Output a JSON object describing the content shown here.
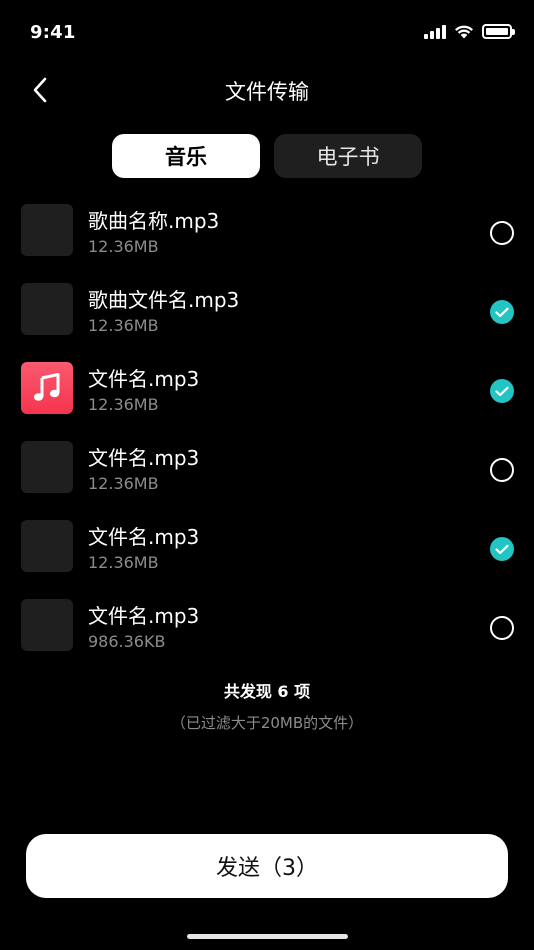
{
  "status_bar": {
    "time": "9:41"
  },
  "nav": {
    "title": "文件传输"
  },
  "tabs": [
    {
      "label": "音乐",
      "active": true
    },
    {
      "label": "电子书",
      "active": false
    }
  ],
  "files": [
    {
      "name": "歌曲名称.mp3",
      "size": "12.36MB",
      "selected": false,
      "thumb": "placeholder"
    },
    {
      "name": "歌曲文件名.mp3",
      "size": "12.36MB",
      "selected": true,
      "thumb": "placeholder"
    },
    {
      "name": "文件名.mp3",
      "size": "12.36MB",
      "selected": true,
      "thumb": "music-app-icon"
    },
    {
      "name": "文件名.mp3",
      "size": "12.36MB",
      "selected": false,
      "thumb": "placeholder"
    },
    {
      "name": "文件名.mp3",
      "size": "12.36MB",
      "selected": true,
      "thumb": "placeholder"
    },
    {
      "name": "文件名.mp3",
      "size": "986.36KB",
      "selected": false,
      "thumb": "placeholder"
    }
  ],
  "summary": {
    "count_text": "共发现 6 项",
    "note_text": "（已过滤大于20MB的文件）"
  },
  "send_button": {
    "label": "发送（3）"
  },
  "colors": {
    "background": "#000000",
    "accent_check": "#23c4c4",
    "thumb_placeholder": "#1f1f1f",
    "music_icon": "#f5354d"
  }
}
